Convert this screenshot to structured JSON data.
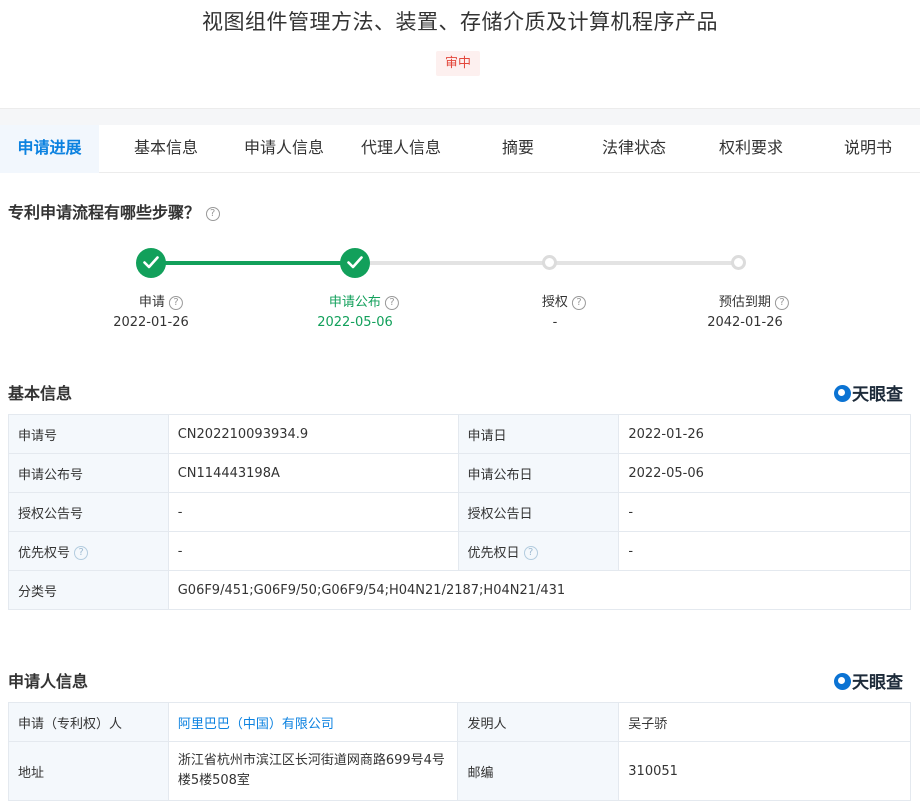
{
  "title": "视图组件管理方法、装置、存储介质及计算机程序产品",
  "status": "审中",
  "tabs": [
    {
      "label": "申请进展",
      "active": true
    },
    {
      "label": "基本信息"
    },
    {
      "label": "申请人信息"
    },
    {
      "label": "代理人信息"
    },
    {
      "label": "摘要"
    },
    {
      "label": "法律状态"
    },
    {
      "label": "权利要求"
    },
    {
      "label": "说明书"
    }
  ],
  "process": {
    "heading": "专利申请流程有哪些步骤？",
    "steps": [
      {
        "label": "申请",
        "date": "2022-01-26",
        "state": "done"
      },
      {
        "label": "申请公布",
        "date": "2022-05-06",
        "state": "current"
      },
      {
        "label": "授权",
        "date": "-",
        "state": "todo"
      },
      {
        "label": "预估到期",
        "date": "2042-01-26",
        "state": "todo"
      }
    ]
  },
  "brand": "天眼查",
  "basic_info": {
    "heading": "基本信息",
    "rows": [
      {
        "l1": "申请号",
        "v1": "CN202210093934.9",
        "l2": "申请日",
        "v2": "2022-01-26"
      },
      {
        "l1": "申请公布号",
        "v1": "CN114443198A",
        "l2": "申请公布日",
        "v2": "2022-05-06"
      },
      {
        "l1": "授权公告号",
        "v1": "-",
        "l2": "授权公告日",
        "v2": "-"
      },
      {
        "l1": "优先权号",
        "v1": "-",
        "l2": "优先权日",
        "v2": "-"
      }
    ],
    "class_label": "分类号",
    "class_value": "G06F9/451;G06F9/50;G06F9/54;H04N21/2187;H04N21/431"
  },
  "applicant_info": {
    "heading": "申请人信息",
    "applicant_label": "申请（专利权）人",
    "applicant_value": "阿里巴巴（中国）有限公司",
    "inventor_label": "发明人",
    "inventor_value": "吴子骄",
    "address_label": "地址",
    "address_value": "浙江省杭州市滨江区长河街道网商路699号4号楼5楼508室",
    "postcode_label": "邮编",
    "postcode_value": "310051"
  },
  "colors": {
    "accent": "#0c82e0",
    "progress": "#12a05b",
    "status": "#e3483c"
  }
}
